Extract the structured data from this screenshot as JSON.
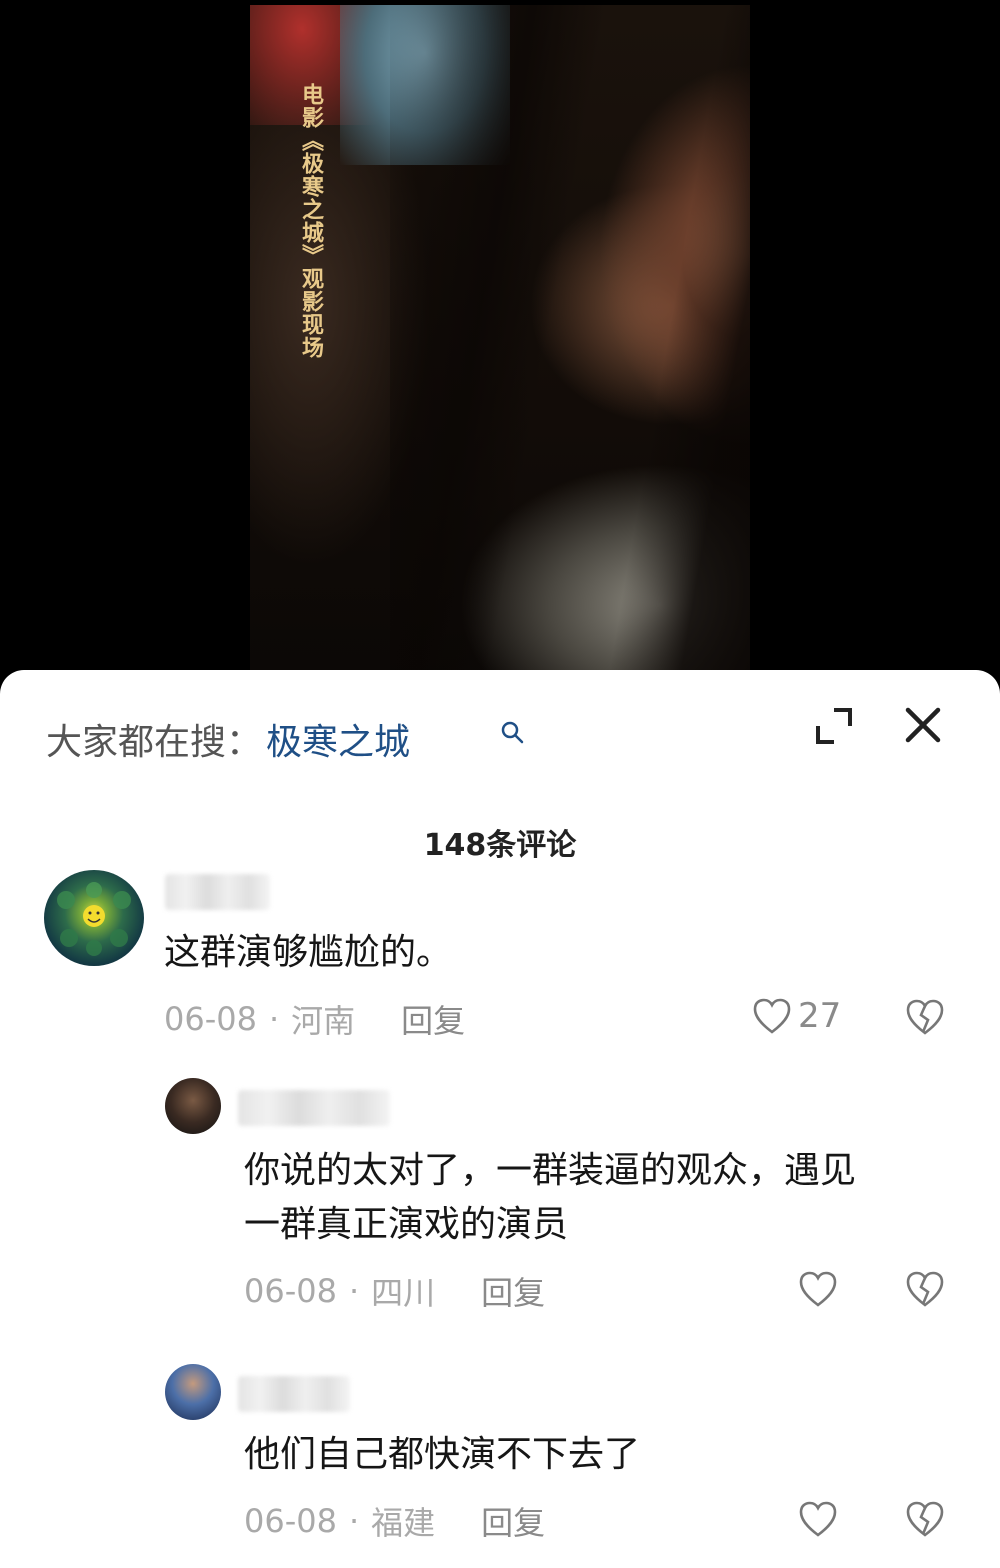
{
  "video": {
    "caption": "电影《极寒之城》观影现场"
  },
  "sheet": {
    "search_prefix": "大家都在搜：",
    "search_term": "极寒之城",
    "comment_count": "148条评论"
  },
  "comments": [
    {
      "text": "这群演够尴尬的。",
      "date": "06-08",
      "location": "河南",
      "reply_label": "回复",
      "likes": "27"
    },
    {
      "text_line1": "你说的太对了，一群装逼的观众，遇见",
      "text_line2": "一群真正演戏的演员",
      "date": "06-08",
      "location": "四川",
      "reply_label": "回复"
    },
    {
      "text": "他们自己都快演不下去了",
      "date": "06-08",
      "location": "福建",
      "reply_label": "回复"
    }
  ],
  "colors": {
    "search_term": "#1f4f86",
    "caption": "#e8c98a",
    "meta": "#a9a9a9"
  },
  "icons": [
    "search-icon",
    "expand-icon",
    "close-icon",
    "heart-icon",
    "broken-heart-icon"
  ]
}
